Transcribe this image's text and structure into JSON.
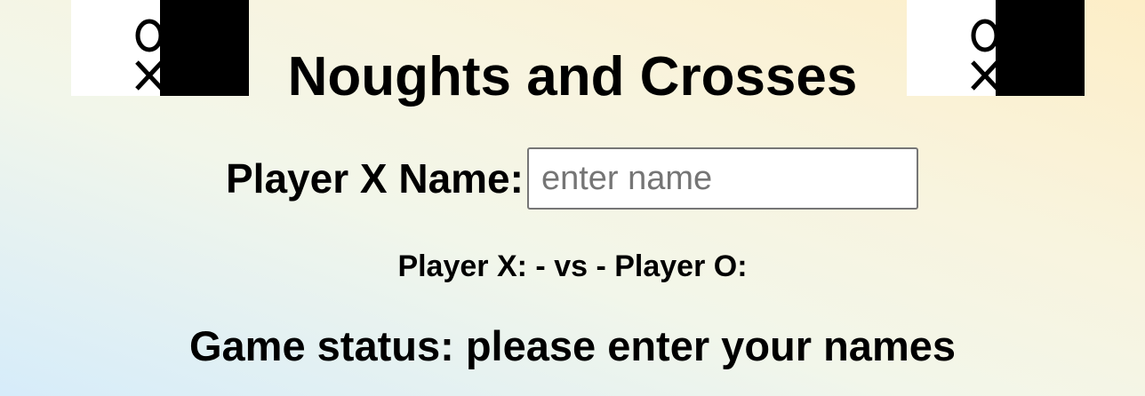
{
  "header": {
    "title": "Noughts and Crosses"
  },
  "logo": {
    "glyphs": "XO",
    "icon": "noughts-and-crosses-logo-icon"
  },
  "player_form": {
    "label": "Player X Name:",
    "input_value": "",
    "input_placeholder": "enter name"
  },
  "matchup": {
    "player_x_label": "Player X:",
    "player_x_name": "",
    "separator": "- vs -",
    "player_o_label": "Player O:",
    "player_o_name": ""
  },
  "status": {
    "prefix": "Game status:",
    "message": "please enter your names"
  }
}
